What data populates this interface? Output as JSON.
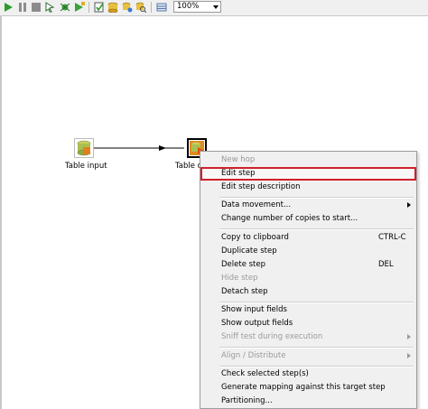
{
  "toolbar": {
    "zoom_value": "100%",
    "icons": [
      "run-icon",
      "pause-icon",
      "stop-icon",
      "preview-icon",
      "debug-icon",
      "replay-icon",
      "check-icon",
      "impact-icon",
      "sql-icon",
      "explore-db-icon",
      "show-results-icon"
    ]
  },
  "canvas": {
    "steps": [
      {
        "label": "Table input"
      },
      {
        "label": "Table o"
      }
    ]
  },
  "context_menu": {
    "items": [
      {
        "label": "New hop",
        "disabled": true
      },
      {
        "label": "Edit step",
        "highlight": true
      },
      {
        "label": "Edit step description"
      },
      {
        "label": "Data movement...",
        "submenu": true
      },
      {
        "label": "Change number of copies to start..."
      },
      {
        "label": "Copy to clipboard",
        "shortcut": "CTRL-C"
      },
      {
        "label": "Duplicate step"
      },
      {
        "label": "Delete step",
        "shortcut": "DEL"
      },
      {
        "label": "Hide step",
        "disabled": true
      },
      {
        "label": "Detach step"
      },
      {
        "label": "Show input fields"
      },
      {
        "label": "Show output fields"
      },
      {
        "label": "Sniff test during execution",
        "disabled": true,
        "submenu": true
      },
      {
        "label": "Align / Distribute",
        "disabled": true,
        "submenu": true
      },
      {
        "label": "Check selected step(s)"
      },
      {
        "label": "Generate mapping against this target step"
      },
      {
        "label": "Partitioning..."
      }
    ]
  },
  "colors": {
    "highlight_border": "#d0202a",
    "hop_line": "#000000"
  }
}
